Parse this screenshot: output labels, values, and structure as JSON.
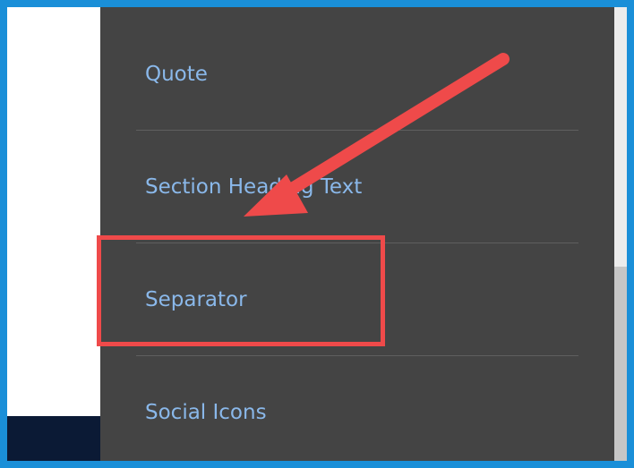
{
  "menu": {
    "items": [
      {
        "label": "Quote"
      },
      {
        "label": "Section Heading Text"
      },
      {
        "label": "Separator"
      },
      {
        "label": "Social Icons"
      }
    ]
  },
  "annotation": {
    "highlighted_item": "Separator",
    "arrow_color": "#ef4a4a",
    "box_color": "#ef4a4a"
  },
  "colors": {
    "frame_border": "#1a8fd8",
    "menu_background": "#444444",
    "menu_text": "#8ab8ea",
    "footer": "#0b1a35"
  }
}
